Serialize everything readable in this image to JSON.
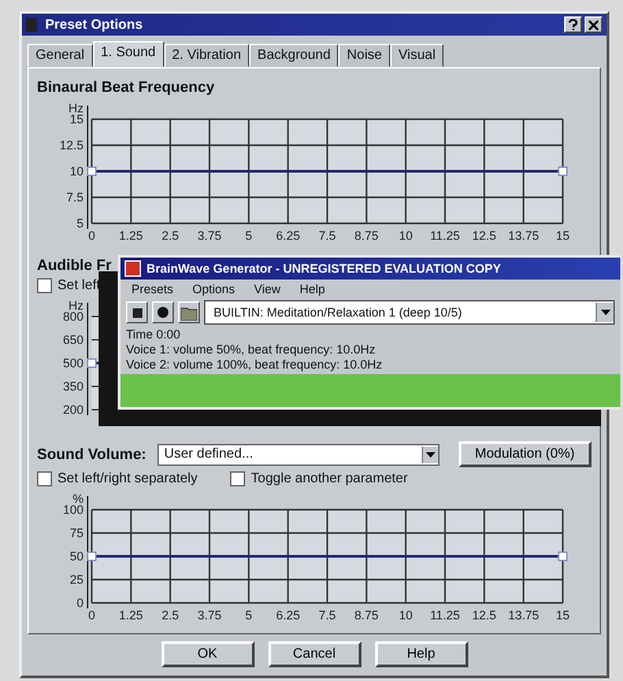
{
  "window": {
    "title": "Preset Options"
  },
  "tabs": [
    {
      "label": "General",
      "selected": false
    },
    {
      "label": "1. Sound",
      "selected": true
    },
    {
      "label": "2. Vibration",
      "selected": false
    },
    {
      "label": "Background",
      "selected": false
    },
    {
      "label": "Noise",
      "selected": false
    },
    {
      "label": "Visual",
      "selected": false
    }
  ],
  "beat_section": {
    "title": "Binaural Beat Frequency",
    "chart_data": {
      "type": "line",
      "ylabel": "Hz",
      "x": [
        0,
        15
      ],
      "grid": true,
      "series": [
        {
          "color": "#202a70",
          "marker": true,
          "values": [
            10,
            10
          ]
        }
      ],
      "xlim": [
        0,
        15
      ],
      "ylim": [
        5,
        15
      ],
      "xticks": [
        0,
        1.25,
        2.5,
        3.75,
        5,
        6.25,
        7.5,
        8.75,
        10,
        11.25,
        12.5,
        13.75,
        15
      ],
      "yticks": [
        5,
        7.5,
        10,
        12.5,
        15
      ]
    }
  },
  "audible_section": {
    "title": "Audible Fr",
    "checkbox": {
      "label": "Set left",
      "checked": false
    },
    "ylabel": "Hz",
    "y_labels": [
      "800",
      "650",
      "500",
      "350",
      "200"
    ]
  },
  "generator_window": {
    "title": "BrainWave Generator - UNREGISTERED EVALUATION COPY",
    "menu": [
      "Presets",
      "Options",
      "View",
      "Help"
    ],
    "preset": {
      "value": "BUILTIN: Meditation/Relaxation 1 (deep 10/5)"
    },
    "status_lines": [
      "Time 0:00",
      "Voice 1: volume 50%, beat frequency: 10.0Hz",
      "Voice 2: volume 100%, beat frequency: 10.0Hz"
    ]
  },
  "volume_section": {
    "label": "Sound Volume:",
    "dropdown": {
      "value": "User defined..."
    },
    "modulation_button": "Modulation (0%)",
    "checkboxes": [
      {
        "label": "Set left/right separately",
        "checked": false
      },
      {
        "label": "Toggle another parameter",
        "checked": false
      }
    ],
    "chart_data": {
      "type": "line",
      "ylabel": "%",
      "x": [
        0,
        15
      ],
      "grid": true,
      "series": [
        {
          "color": "#202a70",
          "marker": true,
          "values": [
            50,
            50
          ]
        }
      ],
      "xlim": [
        0,
        15
      ],
      "ylim": [
        0,
        100
      ],
      "xticks": [
        0,
        1.25,
        2.5,
        3.75,
        5,
        6.25,
        7.5,
        8.75,
        10,
        11.25,
        12.5,
        13.75,
        15
      ],
      "yticks": [
        0,
        25,
        50,
        75,
        100
      ]
    }
  },
  "buttons": [
    "OK",
    "Cancel",
    "Help"
  ]
}
